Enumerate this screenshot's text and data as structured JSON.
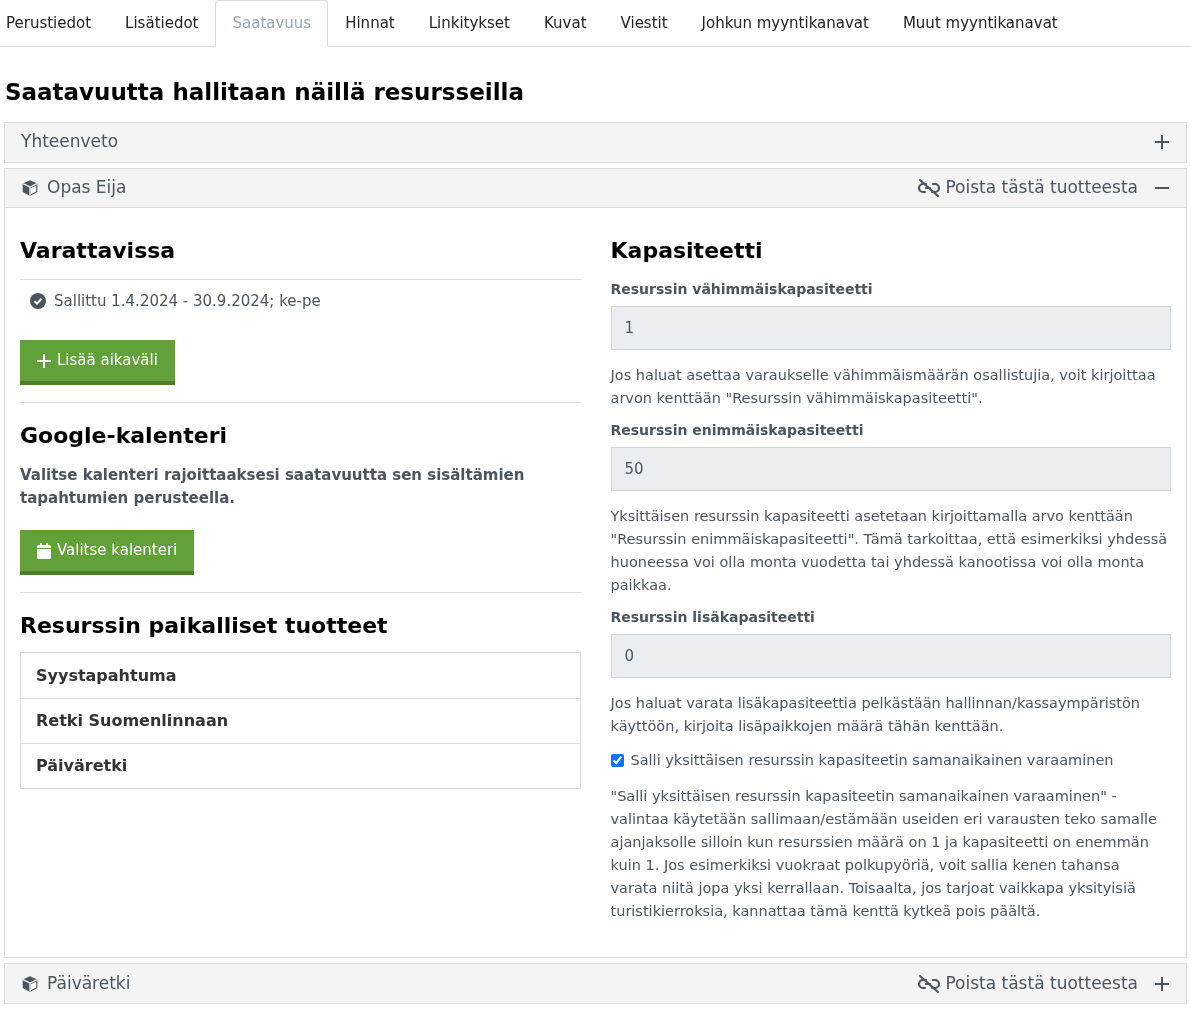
{
  "tabs": [
    {
      "label": "Perustiedot",
      "selected": false
    },
    {
      "label": "Lisätiedot",
      "selected": false
    },
    {
      "label": "Saatavuus",
      "selected": true
    },
    {
      "label": "Hinnat",
      "selected": false
    },
    {
      "label": "Linkitykset",
      "selected": false
    },
    {
      "label": "Kuvat",
      "selected": false
    },
    {
      "label": "Viestit",
      "selected": false
    },
    {
      "label": "Johkun myyntikanavat",
      "selected": false
    },
    {
      "label": "Muut myyntikanavat",
      "selected": false
    }
  ],
  "page_title": "Saatavuutta hallitaan näillä resursseilla",
  "panels": [
    {
      "kind": "summary",
      "title": "Yhteenveto",
      "expanded": false
    },
    {
      "kind": "resource",
      "title": "Opas Eija",
      "remove_label": "Poista tästä tuotteesta",
      "expanded": true,
      "body": {
        "availability": {
          "heading": "Varattavissa",
          "rules": [
            "Sallittu 1.4.2024 - 30.9.2024; ke-pe"
          ],
          "add_button": "Lisää aikaväli"
        },
        "calendar": {
          "heading": "Google-kalenteri",
          "description": "Valitse kalenteri rajoittaaksesi saatavuutta sen sisältämien tapahtumien perusteella.",
          "button": "Valitse kalenteri"
        },
        "local_products": {
          "heading": "Resurssin paikalliset tuotteet",
          "items": [
            "Syystapahtuma",
            "Retki Suomenlinnaan",
            "Päiväretki"
          ]
        },
        "capacity": {
          "heading": "Kapasiteetti",
          "items": [
            {
              "kind": "field",
              "label": "Resurssin vähimmäiskapasiteetti",
              "value": "1"
            },
            {
              "kind": "help",
              "text": "Jos haluat asettaa varaukselle vähimmäismäärän osallistujia, voit kirjoittaa arvon kenttään \"Resurssin vähimmäiskapasiteetti\"."
            },
            {
              "kind": "field",
              "label": "Resurssin enimmäiskapasiteetti",
              "value": "50"
            },
            {
              "kind": "help",
              "text": "Yksittäisen resurssin kapasiteetti asetetaan kirjoittamalla arvo kenttään \"Resurssin enimmäiskapasiteetti\". Tämä tarkoittaa, että esimerkiksi yhdessä huoneessa voi olla monta vuodetta tai yhdessä kanootissa voi olla monta paikkaa."
            },
            {
              "kind": "field",
              "label": "Resurssin lisäkapasiteetti",
              "value": "0"
            },
            {
              "kind": "help",
              "text": "Jos haluat varata lisäkapasiteettia pelkästään hallinnan/kassaympäristön käyttöön, kirjoita lisäpaikkojen määrä tähän kenttään."
            },
            {
              "kind": "checkbox",
              "label": "Salli yksittäisen resurssin kapasiteetin samanaikainen varaaminen",
              "checked": true
            },
            {
              "kind": "help",
              "text": "\"Salli yksittäisen resurssin kapasiteetin samanaikainen varaaminen\" -valintaa käytetään sallimaan/estämään useiden eri varausten teko samalle ajanjaksolle silloin kun resurssien määrä on 1 ja kapasiteetti on enemmän kuin 1. Jos esimerkiksi vuokraat polkupyöriä, voit sallia kenen tahansa varata niitä jopa yksi kerrallaan. Toisaalta, jos tarjoat vaikkapa yksityisiä turistikierroksia, kannattaa tämä kenttä kytkeä pois päältä."
            }
          ]
        }
      }
    },
    {
      "kind": "resource",
      "title": "Päiväretki",
      "remove_label": "Poista tästä tuotteesta",
      "expanded": false
    }
  ]
}
